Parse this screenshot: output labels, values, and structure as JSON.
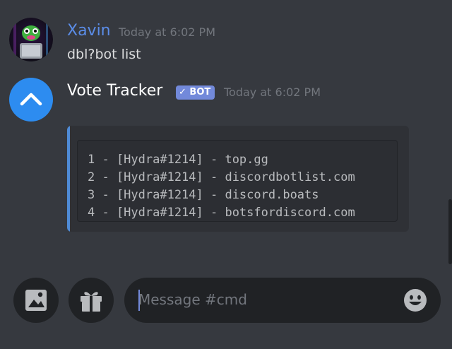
{
  "messages": [
    {
      "author": "Xavin",
      "author_color": "#5b8de8",
      "timestamp": "Today at 6:02 PM",
      "content": "dbl?bot list"
    },
    {
      "author": "Vote Tracker",
      "author_color": "#ffffff",
      "bot_tag": "✓ BOT",
      "timestamp": "Today at 6:02 PM",
      "code_lines": [
        "1 - [Hydra#1214] - top.gg",
        "2 - [Hydra#1214] - discordbotlist.com",
        "3 - [Hydra#1214] - discord.boats",
        "4 - [Hydra#1214] - botsfordiscord.com"
      ]
    }
  ],
  "composer": {
    "placeholder": "Message #cmd",
    "image_button_icon": "image-icon",
    "gift_button_icon": "gift-icon",
    "emoji_button_icon": "emoji-icon"
  },
  "colors": {
    "background": "#36393f",
    "accent": "#7289da",
    "embed_bar": "#4f8bd6"
  }
}
